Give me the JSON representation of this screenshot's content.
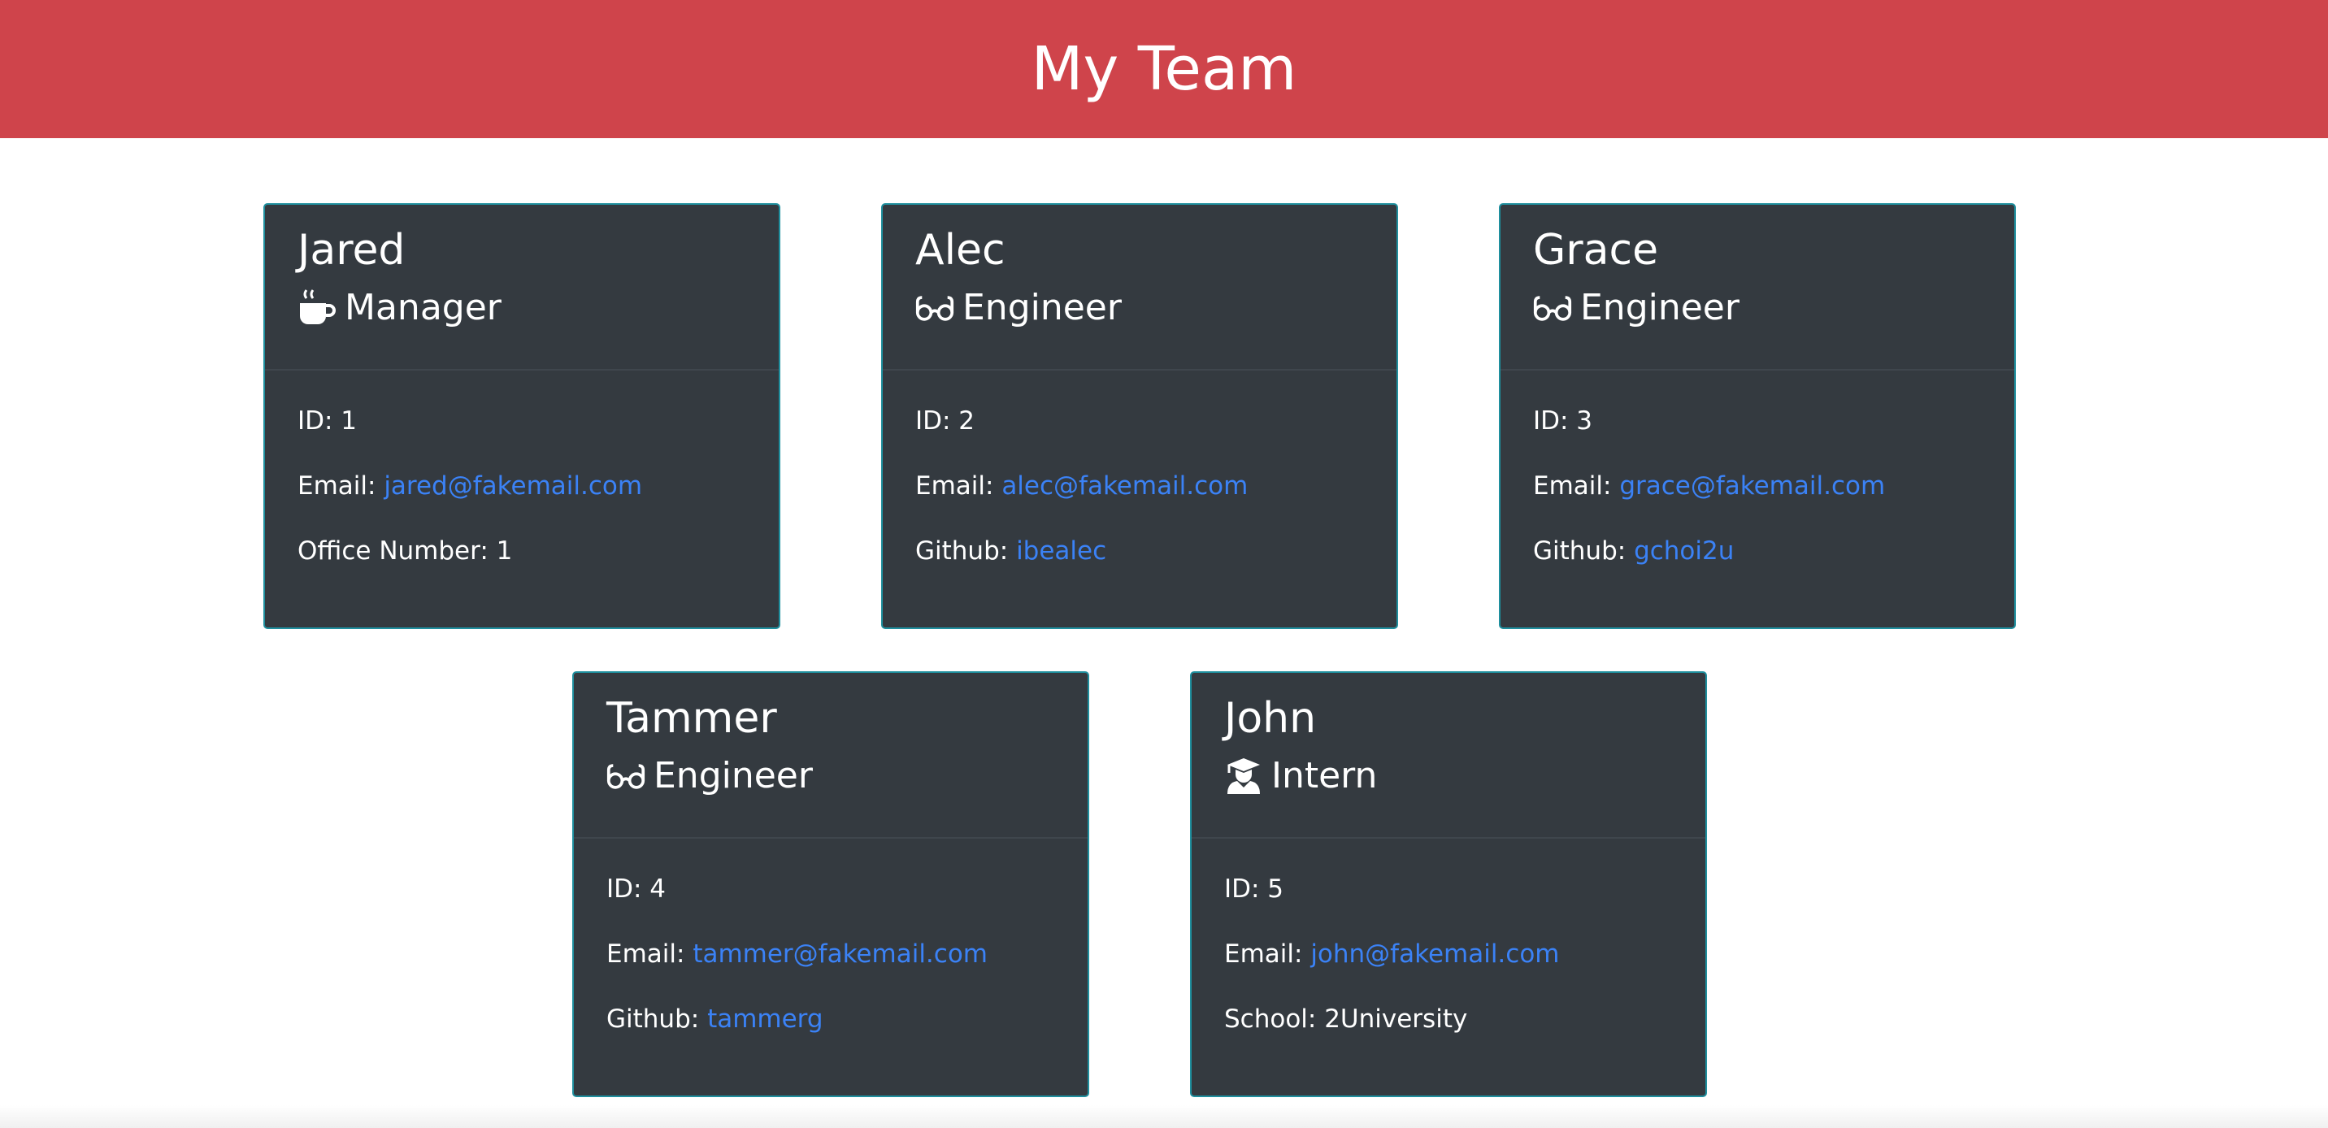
{
  "header": {
    "title": "My Team"
  },
  "colors": {
    "header_bg": "#cf444b",
    "card_bg": "#343a40",
    "card_border": "#1f8f9e",
    "link": "#3b82f6"
  },
  "members": [
    {
      "name": "Jared",
      "role": "Manager",
      "icon": "coffee-icon",
      "id_label": "ID: 1",
      "email_prefix": "Email: ",
      "email": "jared@fakemail.com",
      "extra_prefix": "Office Number: 1",
      "extra_value": ""
    },
    {
      "name": "Alec",
      "role": "Engineer",
      "icon": "glasses-icon",
      "id_label": "ID: 2",
      "email_prefix": "Email: ",
      "email": "alec@fakemail.com",
      "extra_prefix": "Github: ",
      "extra_value": "ibealec"
    },
    {
      "name": "Grace",
      "role": "Engineer",
      "icon": "glasses-icon",
      "id_label": "ID: 3",
      "email_prefix": "Email: ",
      "email": "grace@fakemail.com",
      "extra_prefix": "Github: ",
      "extra_value": "gchoi2u"
    },
    {
      "name": "Tammer",
      "role": "Engineer",
      "icon": "glasses-icon",
      "id_label": "ID: 4",
      "email_prefix": "Email: ",
      "email": "tammer@fakemail.com",
      "extra_prefix": "Github: ",
      "extra_value": "tammerg"
    },
    {
      "name": "John",
      "role": "Intern",
      "icon": "graduate-icon",
      "id_label": "ID: 5",
      "email_prefix": "Email: ",
      "email": "john@fakemail.com",
      "extra_prefix": "School: 2University",
      "extra_value": ""
    }
  ]
}
